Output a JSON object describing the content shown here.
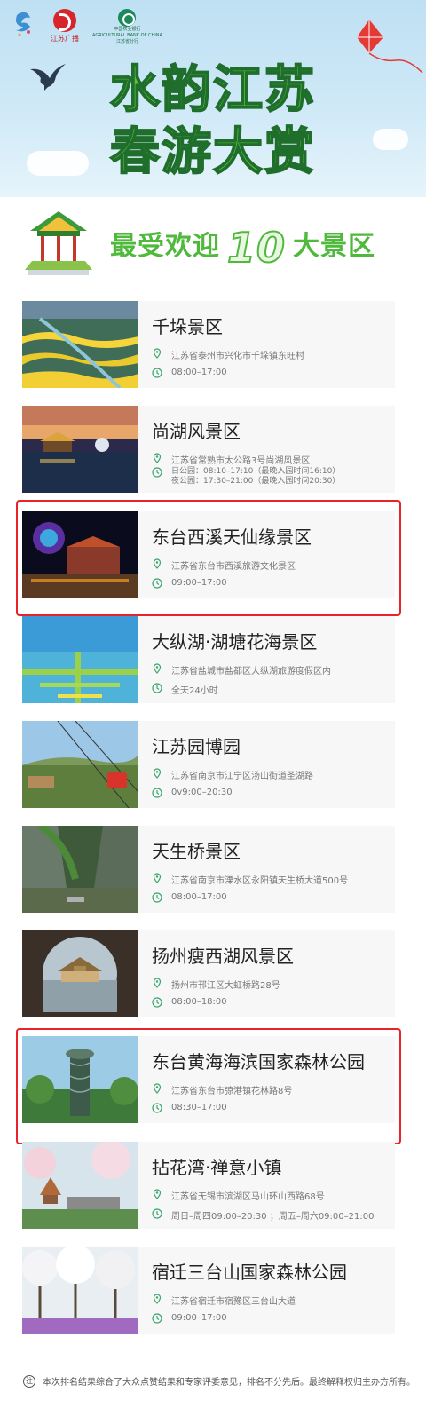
{
  "header": {
    "title_line1": "水韵江苏",
    "title_line2": "春游大赏",
    "logo_jiangsu_text": "江苏广播",
    "logo_bank_text_cn": "中国农业银行",
    "logo_bank_text_en": "AGRICULTURAL BANK OF CHINA",
    "logo_bank_sub": "江苏省分行"
  },
  "section": {
    "title_prefix": "最受欢迎",
    "title_number": "10",
    "title_suffix": "大景区"
  },
  "spots": [
    {
      "name": "千垛景区",
      "address": "江苏省泰州市兴化市千垛镇东旺村",
      "hours": "08:00–17:00"
    },
    {
      "name": "尚湖风景区",
      "address": "江苏省常熟市太公路3号尚湖风景区",
      "hours_line1": "日公园：08:10–17:10（最晚入园时间16:10）",
      "hours_line2": "夜公园：17:30–21:00（最晚入园时间20:30）"
    },
    {
      "name": "东台西溪天仙缘景区",
      "address": "江苏省东台市西溪旅游文化景区",
      "hours": "09:00–17:00"
    },
    {
      "name": "大纵湖·湖塘花海景区",
      "address": "江苏省盐城市盐都区大纵湖旅游度假区内",
      "hours": "全天24小时"
    },
    {
      "name": "江苏园博园",
      "address": "江苏省南京市江宁区汤山街道圣湖路",
      "hours": "0v9:00–20:30"
    },
    {
      "name": "天生桥景区",
      "address": "江苏省南京市溧水区永阳镇天生桥大道500号",
      "hours": "08:00–17:00"
    },
    {
      "name": "扬州瘦西湖风景区",
      "address": "扬州市邗江区大虹桥路28号",
      "hours": "08:00–18:00"
    },
    {
      "name": "东台黄海海滨国家森林公园",
      "address": "江苏省东台市弶港镇花林路8号",
      "hours": "08:30–17:00"
    },
    {
      "name": "拈花湾·禅意小镇",
      "address": "江苏省无锡市滨湖区马山环山西路68号",
      "hours": "周日–周四09:00–20:30 ；周五–周六09:00–21:00"
    },
    {
      "name": "宿迁三台山国家森林公园",
      "address": "江苏省宿迁市宿豫区三台山大道",
      "hours": "09:00–17:00"
    }
  ],
  "footer": {
    "note": "本次排名结果综合了大众点赞结果和专家评委意见，排名不分先后。最终解释权归主办方所有。"
  },
  "colors": {
    "accent_green": "#4fb93c",
    "highlight_red": "#e8242a",
    "card_bg": "#f7f7f7",
    "icon_green": "#3aa76d"
  }
}
